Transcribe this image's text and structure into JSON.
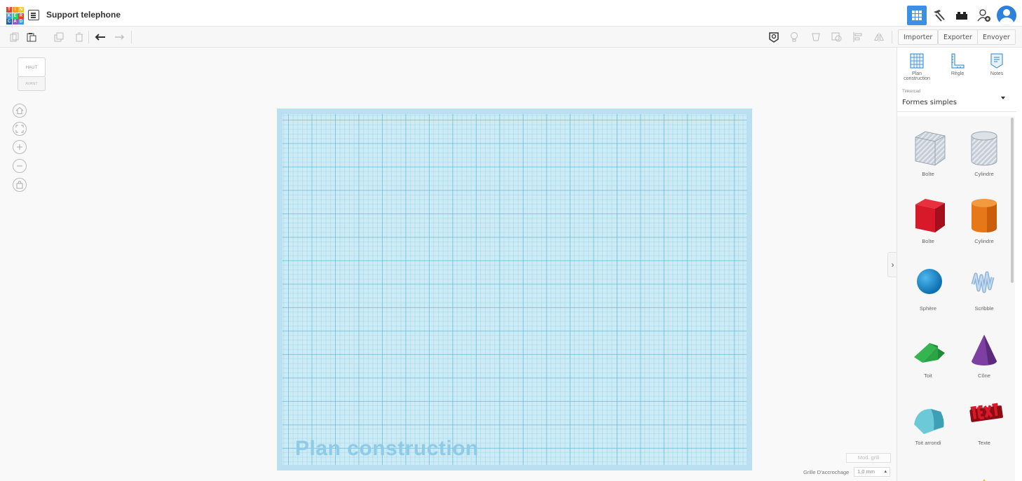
{
  "header": {
    "logo_letters": [
      "T",
      "I",
      "N",
      "K",
      "E",
      "R",
      "C",
      "A",
      "D"
    ],
    "logo_colors": [
      "#e8412c",
      "#f39c1f",
      "#f5c518",
      "#3a9de1",
      "#2ecc71",
      "#e8412c",
      "#1a5fb4",
      "#9b59b6",
      "#3a9de1"
    ],
    "design_title": "Support telephone",
    "views": [
      "grid-view-icon",
      "build-icon",
      "bricks-icon",
      "add-user-icon",
      "avatar"
    ]
  },
  "toolbar": {
    "left_icons": [
      "copy-icon",
      "paste-icon",
      "duplicate-icon",
      "delete-icon",
      "undo-icon",
      "redo-icon"
    ],
    "right_icons": [
      "note-icon",
      "light-bulb-icon",
      "group-icon",
      "ungroup-icon",
      "align-icon",
      "mirror-icon"
    ],
    "import_label": "Importer",
    "export_label": "Exporter",
    "send_label": "Envoyer"
  },
  "viewcube": {
    "top_label": "HAUT",
    "front_label": "AVANT"
  },
  "nav_buttons": [
    "home-view-icon",
    "fit-view-icon",
    "zoom-in-icon",
    "zoom-out-icon",
    "perspective-icon"
  ],
  "workplane": {
    "label": "Plan construction"
  },
  "bottom": {
    "edit_grid_label": "Mod. grill",
    "snap_label": "Grille D'accrochage",
    "snap_value": "1,0 mm"
  },
  "right_panel": {
    "tools": [
      {
        "label": "Plan construction",
        "icon": "workplane-icon"
      },
      {
        "label": "Règle",
        "icon": "ruler-icon"
      },
      {
        "label": "Notes",
        "icon": "notes-icon"
      }
    ],
    "library_small": "Tinkercad",
    "library_selected": "Formes simples",
    "shapes": [
      {
        "label": "Boîte",
        "icon": "box-hole-icon",
        "color": "#b9c3cf"
      },
      {
        "label": "Cylindre",
        "icon": "cylinder-hole-icon",
        "color": "#c1c8d2"
      },
      {
        "label": "Boîte",
        "icon": "box-icon",
        "color": "#d7192a"
      },
      {
        "label": "Cylindre",
        "icon": "cylinder-icon",
        "color": "#e77817"
      },
      {
        "label": "Sphère",
        "icon": "sphere-icon",
        "color": "#138fd3"
      },
      {
        "label": "Scribble",
        "icon": "scribble-icon",
        "color": "#9fc1e3"
      },
      {
        "label": "Toit",
        "icon": "roof-icon",
        "color": "#2aa444"
      },
      {
        "label": "Cône",
        "icon": "cone-icon",
        "color": "#7d3fa1"
      },
      {
        "label": "Toit arrondi",
        "icon": "round-roof-icon",
        "color": "#5fbfd0"
      },
      {
        "label": "Texte",
        "icon": "text-icon",
        "color": "#c8161f"
      }
    ]
  }
}
